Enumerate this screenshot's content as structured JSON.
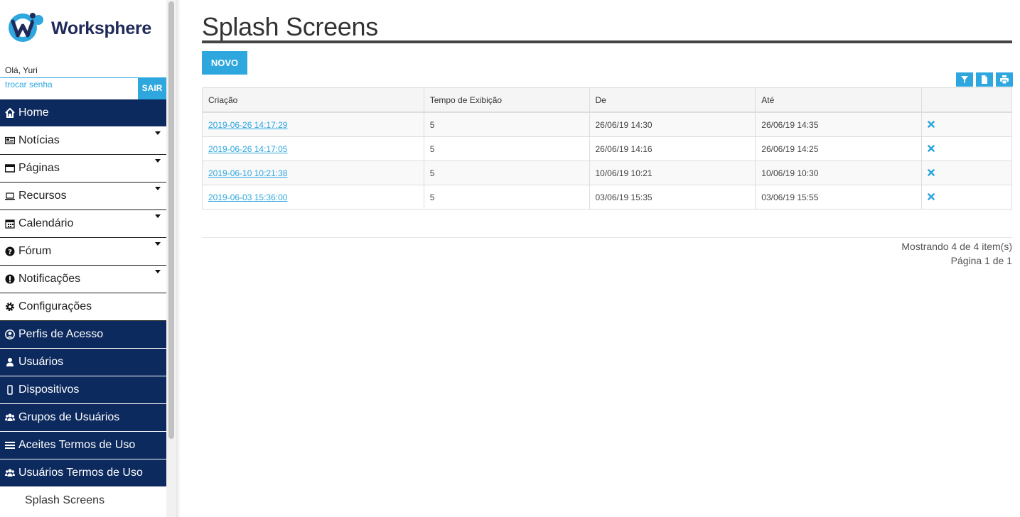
{
  "brand": {
    "name": "Worksphere"
  },
  "user": {
    "greeting": "Olá, Yuri",
    "change_password": "trocar senha",
    "logout": "SAIR"
  },
  "menu": [
    {
      "label": "Home",
      "icon": "home-icon",
      "style": "dark",
      "caret": false
    },
    {
      "label": "Notícias",
      "icon": "newspaper-icon",
      "style": "light",
      "caret": true
    },
    {
      "label": "Páginas",
      "icon": "window-icon",
      "style": "light",
      "caret": true
    },
    {
      "label": "Recursos",
      "icon": "laptop-icon",
      "style": "light",
      "caret": true
    },
    {
      "label": "Calendário",
      "icon": "calendar-icon",
      "style": "light",
      "caret": true
    },
    {
      "label": "Fórum",
      "icon": "question-icon",
      "style": "light",
      "caret": true
    },
    {
      "label": "Notificações",
      "icon": "exclamation-icon",
      "style": "light",
      "caret": true
    },
    {
      "label": "Configurações",
      "icon": "gear-icon",
      "style": "light",
      "caret": false
    },
    {
      "label": "Perfis de Acesso",
      "icon": "user-circle-icon",
      "style": "dark",
      "caret": false
    },
    {
      "label": "Usuários",
      "icon": "user-icon",
      "style": "dark",
      "caret": false
    },
    {
      "label": "Dispositivos",
      "icon": "mobile-icon",
      "style": "dark",
      "caret": false
    },
    {
      "label": "Grupos de Usuários",
      "icon": "users-icon",
      "style": "dark",
      "caret": false
    },
    {
      "label": "Aceites Termos de Uso",
      "icon": "list-icon",
      "style": "dark",
      "caret": false
    },
    {
      "label": "Usuários Termos de Uso",
      "icon": "users-icon",
      "style": "dark",
      "caret": false
    },
    {
      "label": "Splash Screens",
      "icon": "",
      "style": "sub",
      "caret": false
    }
  ],
  "page": {
    "title": "Splash Screens",
    "new_button": "NOVO"
  },
  "toolbar": {
    "icons": [
      "filter-icon",
      "file-icon",
      "print-icon"
    ]
  },
  "table": {
    "headers": [
      "Criação",
      "Tempo de Exibição",
      "De",
      "Até",
      ""
    ],
    "rows": [
      {
        "created": "2019-06-26 14:17:29",
        "duration": "5",
        "from": "26/06/19 14:30",
        "to": "26/06/19 14:35"
      },
      {
        "created": "2019-06-26 14:17:05",
        "duration": "5",
        "from": "26/06/19 14:16",
        "to": "26/06/19 14:25"
      },
      {
        "created": "2019-06-10 10:21:38",
        "duration": "5",
        "from": "10/06/19 10:21",
        "to": "10/06/19 10:30"
      },
      {
        "created": "2019-06-03 15:36:00",
        "duration": "5",
        "from": "03/06/19 15:35",
        "to": "03/06/19 15:55"
      }
    ]
  },
  "pagination": {
    "showing": "Mostrando 4 de 4 item(s)",
    "page": "Página 1 de 1"
  },
  "colors": {
    "accent": "#2ea7df",
    "nav_dark": "#0d2a5e"
  }
}
